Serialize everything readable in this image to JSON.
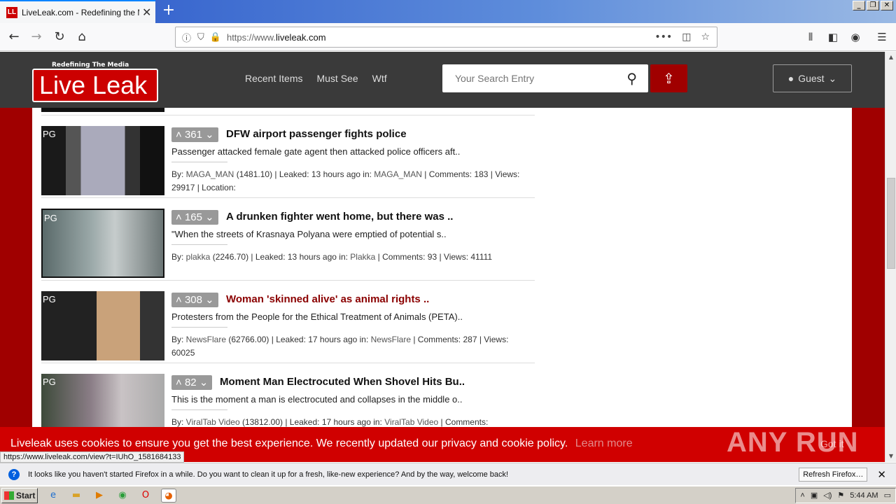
{
  "browser": {
    "tab_title": "LiveLeak.com - Redefining the Media",
    "tab_favicon": "LL",
    "url_prefix": "https://www.",
    "url_domain": "liveleak.com",
    "url_suffix": ".com",
    "accent": "#0a84ff"
  },
  "site": {
    "logo_tag": "Redefining The Media",
    "logo_text": "Live Leak",
    "nav": [
      "Recent Items",
      "Must See",
      "Wtf"
    ],
    "search_placeholder": "Your Search Entry",
    "user_label": "Guest",
    "brand_color": "#a00000"
  },
  "items": [
    {
      "rating": "PG",
      "votes": "361",
      "title": "DFW airport passenger fights police",
      "desc": "Passenger attacked female gate agent then attacked police officers aft..",
      "by_label": "By: ",
      "user": "MAGA_MAN",
      "score": " (1481.10) | Leaked: 13 hours ago in: ",
      "channel": "MAGA_MAN",
      "stats": " | Comments: 183 | Views: 29917 | Location:"
    },
    {
      "rating": "PG",
      "votes": "165",
      "title": "A drunken fighter went home, but there was ..",
      "desc": "\"When the streets of Krasnaya Polyana were emptied of potential s..",
      "by_label": "By: ",
      "user": "plakka",
      "score": " (2246.70) | Leaked: 13 hours ago in: ",
      "channel": "Plakka",
      "stats": " | Comments: 93 | Views: 41111"
    },
    {
      "rating": "PG",
      "votes": "308",
      "title": "Woman 'skinned alive' as animal rights ..",
      "desc": "Protesters from the People for the Ethical Treatment of Animals (PETA)..",
      "by_label": "By: ",
      "user": "NewsFlare",
      "score": " (62766.00) | Leaked: 17 hours ago in: ",
      "channel": "NewsFlare",
      "stats": " | Comments: 287 | Views: 60025"
    },
    {
      "rating": "PG",
      "votes": "82",
      "title": "Moment Man Electrocuted When Shovel Hits Bu..",
      "desc": "This is the moment a man is electrocuted and collapses in the middle o..",
      "by_label": "By: ",
      "user": "ViralTab Video",
      "score": " (13812.00) | Leaked: 17 hours ago in: ",
      "channel": "ViralTab Video",
      "stats": " | Comments:"
    }
  ],
  "cookie": {
    "text": "Liveleak uses cookies to ensure you get the best experience. We recently updated our privacy and cookie policy.",
    "learn": "Learn more",
    "got_it": "Got it"
  },
  "watermark": "ANY RUN",
  "status_url": "https://www.liveleak.com/view?t=IUhO_1581684133",
  "notification": {
    "message": "It looks like you haven't started Firefox in a while. Do you want to clean it up for a fresh, like-new experience? And by the way, welcome back!",
    "button": "Refresh Firefox…"
  },
  "taskbar": {
    "start": "Start",
    "time": "5:44 AM"
  }
}
